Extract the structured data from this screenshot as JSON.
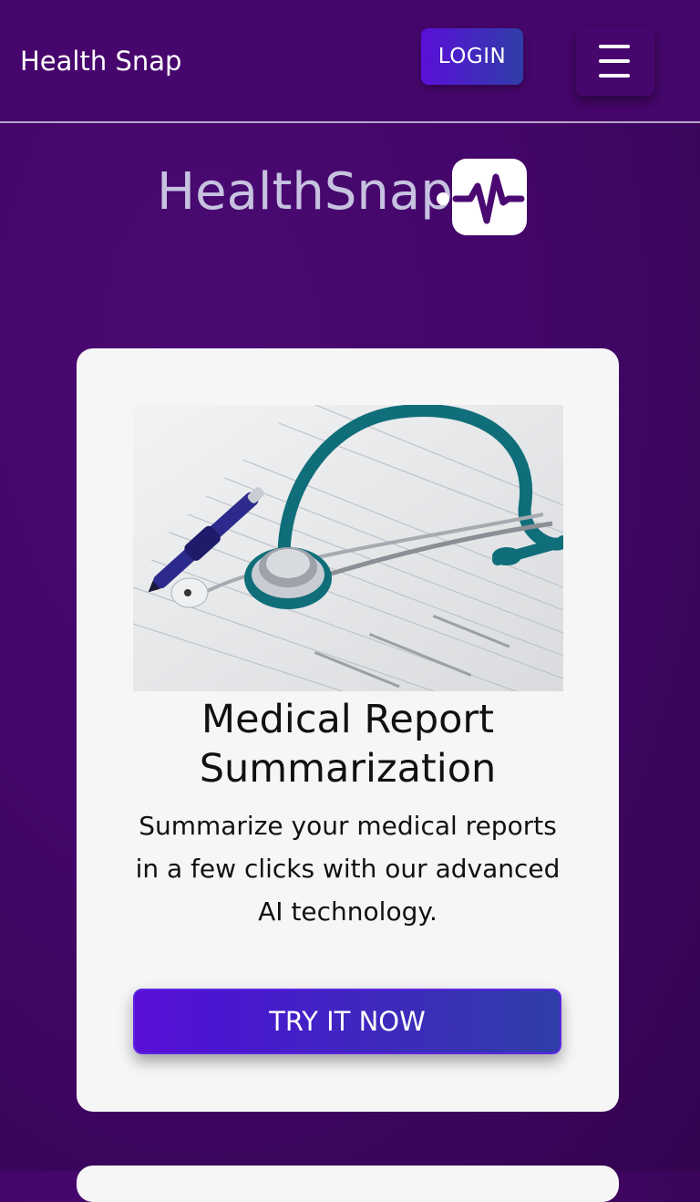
{
  "navbar": {
    "brand": "Health Snap",
    "login_label": "LOGIN",
    "menu_icon": "hamburger-icon"
  },
  "logo": {
    "text": "HealthSnap",
    "icon": "heartbeat-pulse-icon"
  },
  "feature_card": {
    "title": "Medical Report Summarization",
    "description": "Summarize your medical reports in a few clicks with our advanced AI technology.",
    "cta_label": "TRY IT NOW",
    "image": "stethoscope-on-medical-report-photo"
  },
  "colors": {
    "background": "#44066a",
    "accent_start": "#5a0fd8",
    "accent_end": "#2f3ea8",
    "card": "#f6f6f7",
    "logo_text": "#c7c2e0"
  }
}
